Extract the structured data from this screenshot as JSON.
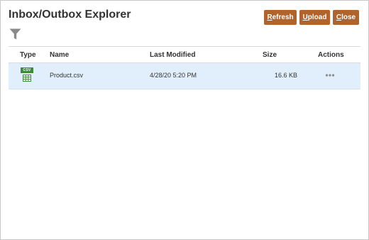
{
  "dialog": {
    "title": "Inbox/Outbox Explorer"
  },
  "toolbar": {
    "refresh": {
      "accel": "R",
      "rest": "efresh"
    },
    "upload": {
      "accel": "U",
      "rest": "pload"
    },
    "close": {
      "accel": "C",
      "rest": "lose"
    }
  },
  "filter": {
    "icon": "filter-icon"
  },
  "table": {
    "columns": {
      "type": "Type",
      "name": "Name",
      "last_modified": "Last Modified",
      "size": "Size",
      "actions": "Actions"
    },
    "rows": [
      {
        "type_icon": "csv-file-icon",
        "type_badge": "CSV",
        "name": "Product.csv",
        "last_modified": "4/28/20 5:20 PM",
        "size": "16.6 KB",
        "actions_icon": "more-horizontal-icon"
      }
    ]
  },
  "colors": {
    "button_bg": "#b0642c",
    "selected_row_bg": "#e1effc",
    "csv_green": "#3f8a3b",
    "icon_gray": "#8a8a8a"
  }
}
